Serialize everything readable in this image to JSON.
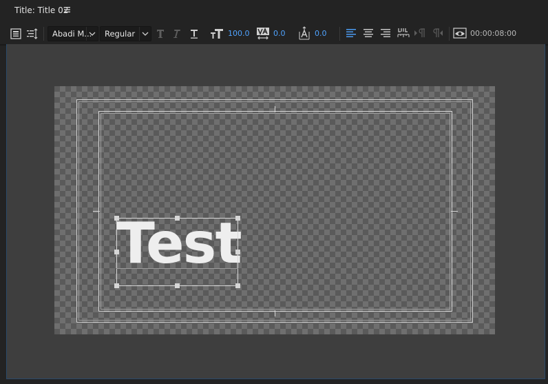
{
  "panel": {
    "title": "Title: Title 02",
    "menu_icon": "hamburger-menu-icon"
  },
  "toolbar": {
    "roll_crawl_icon": "roll-crawl-options-icon",
    "tab_stops_icon": "tab-stops-icon",
    "font_family": "Abadi M...",
    "font_style": "Regular",
    "bold_icon": "bold-T-icon",
    "italic_icon": "italic-T-icon",
    "underline_icon": "underline-T-icon",
    "font_size_icon": "font-size-icon",
    "font_size": "100.0",
    "kerning_icon": "kerning-VA-icon",
    "kerning": "0.0",
    "leading_icon": "leading-icon",
    "leading": "0.0",
    "align_left_icon": "align-left-icon",
    "align_center_icon": "align-center-icon",
    "align_right_icon": "align-right-icon",
    "tab_icon": "tab-ruler-icon",
    "indent_left_icon": "indent-left-icon",
    "indent_right_icon": "indent-right-icon",
    "show_background_icon": "show-background-video-icon",
    "timecode": "00:00:08:00",
    "active_color": "#4fa3ff"
  },
  "canvas": {
    "text_layer": "Test",
    "background": "checkerboard-transparency"
  }
}
